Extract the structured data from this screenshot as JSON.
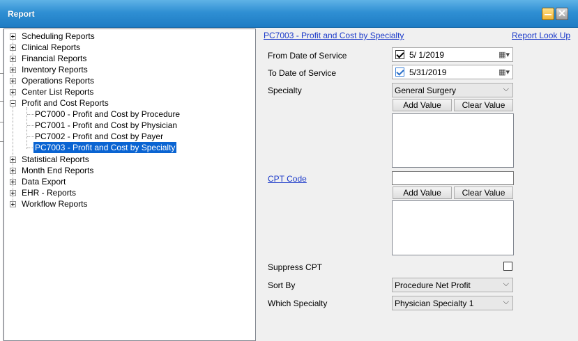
{
  "window": {
    "title": "Report"
  },
  "tree": {
    "groups": [
      {
        "label": "Scheduling Reports"
      },
      {
        "label": "Clinical Reports"
      },
      {
        "label": "Financial Reports"
      },
      {
        "label": "Inventory Reports"
      },
      {
        "label": "Operations Reports"
      },
      {
        "label": "Center List Reports"
      },
      {
        "label": "Profit and Cost Reports",
        "children": [
          "PC7000 - Profit and Cost by Procedure",
          "PC7001 - Profit and Cost by Physician",
          "PC7002 - Profit and Cost by Payer",
          "PC7003 - Profit and Cost by Specialty"
        ]
      },
      {
        "label": "Statistical Reports"
      },
      {
        "label": "Month End Reports"
      },
      {
        "label": "Data Export"
      },
      {
        "label": "EHR - Reports"
      },
      {
        "label": "Workflow Reports"
      }
    ],
    "selected": "PC7003 - Profit and Cost by Specialty"
  },
  "report": {
    "title": "PC7003 - Profit and Cost by Specialty",
    "lookup_link": "Report Look Up",
    "from_label": "From Date of Service",
    "from_value": "5/  1/2019",
    "from_checked": true,
    "to_label": "To Date of Service",
    "to_value": "5/31/2019",
    "to_checked": true,
    "specialty_label": "Specialty",
    "specialty_value": "General Surgery",
    "add_value": "Add Value",
    "clear_value": "Clear Value",
    "cpt_label": "CPT Code",
    "cpt_value": "",
    "suppress_label": "Suppress CPT",
    "suppress_checked": false,
    "sortby_label": "Sort By",
    "sortby_value": "Procedure Net Profit",
    "which_label": "Which Specialty",
    "which_value": "Physician Specialty 1"
  },
  "icons": {
    "minimize": "minimize-icon",
    "close": "close-icon",
    "calendar": "calendar-icon",
    "dropdown": "chevron-down-icon"
  }
}
